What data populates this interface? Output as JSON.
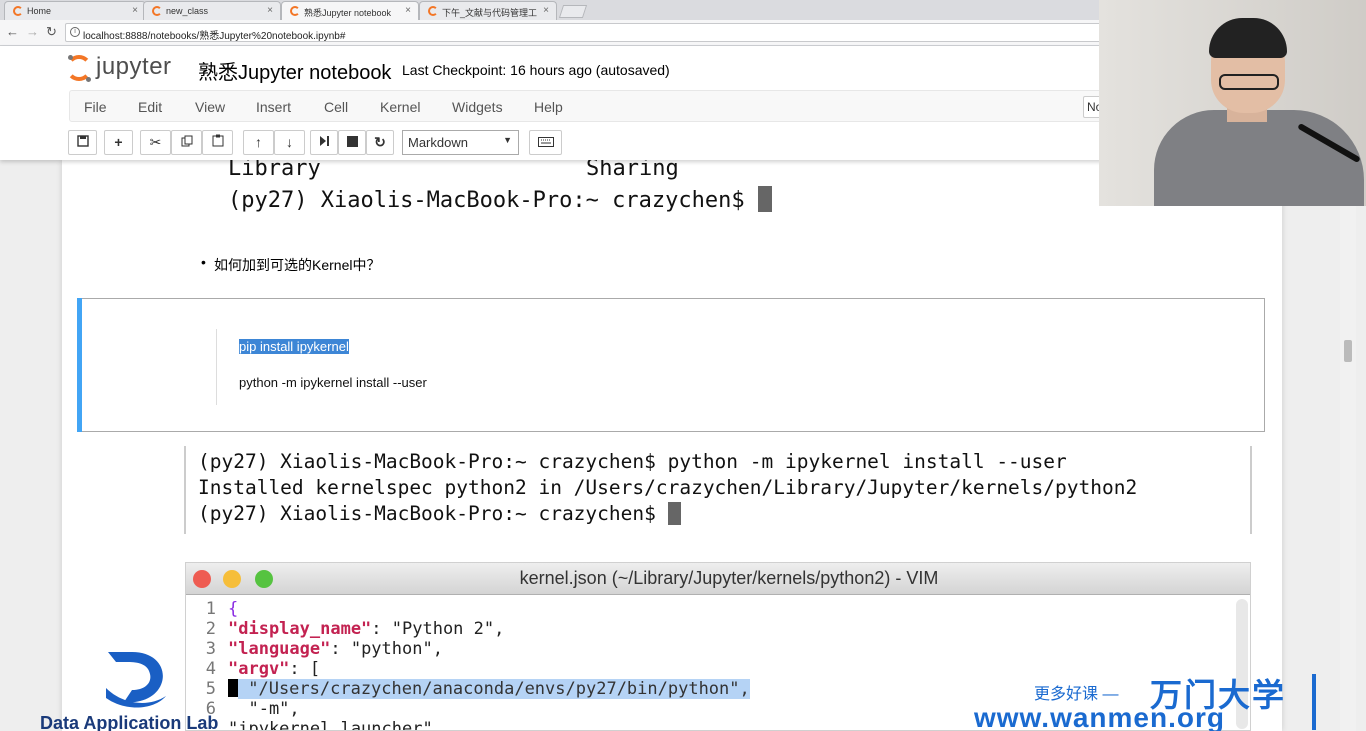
{
  "browser": {
    "tabs": [
      {
        "label": "Home",
        "active": false
      },
      {
        "label": "new_class",
        "active": false
      },
      {
        "label": "熟悉Jupyter notebook",
        "active": true
      },
      {
        "label": "下午_文献与代码管理工",
        "active": false
      }
    ],
    "close_glyph": "×",
    "url": "localhost:8888/notebooks/熟悉Jupyter%20notebook.ipynb#"
  },
  "jupyter": {
    "logo_text": "jupyter",
    "notebook_name": "熟悉Jupyter notebook",
    "checkpoint": "Last Checkpoint: 16 hours ago (autosaved)",
    "menu": [
      "File",
      "Edit",
      "View",
      "Insert",
      "Cell",
      "Kernel",
      "Widgets",
      "Help"
    ],
    "kernel_indicator": "No",
    "cell_type": "Markdown",
    "toolbar_icons": [
      "save-icon",
      "plus-icon",
      "scissors-icon",
      "copy-icon",
      "paste-icon",
      "arrow-up-icon",
      "arrow-down-icon",
      "run-icon",
      "stop-icon",
      "restart-icon",
      "keyboard-icon"
    ]
  },
  "content": {
    "terminal_top": {
      "line1_left": "Library",
      "line1_right": "Sharing",
      "line2": "(py27) Xiaolis-MacBook-Pro:~ crazychen$"
    },
    "bullet": "如何加到可选的Kernel中？",
    "markdown_cell": {
      "line1": "pip install ipykernel",
      "line2": "python -m ipykernel install --user"
    },
    "terminal2": [
      "(py27) Xiaolis-MacBook-Pro:~ crazychen$ python -m ipykernel install --user",
      "Installed kernelspec python2 in /Users/crazychen/Library/Jupyter/kernels/python2",
      "(py27) Xiaolis-MacBook-Pro:~ crazychen$"
    ],
    "vim": {
      "title": "kernel.json (~/Library/Jupyter/kernels/python2) - VIM",
      "lines": [
        {
          "n": "1",
          "t": "{"
        },
        {
          "n": "2",
          "k": "\"display_name\"",
          "v": ": \"Python 2\","
        },
        {
          "n": "3",
          "k": "\"language\"",
          "v": ": \"python\","
        },
        {
          "n": "4",
          "k": "\"argv\"",
          "v": ": ["
        },
        {
          "n": "5",
          "t": " \"/Users/crazychen/anaconda/envs/py27/bin/python\","
        },
        {
          "n": "6",
          "t": "  \"-m\","
        },
        {
          "n": "",
          "t": "\"ipykernel_launcher\","
        }
      ]
    }
  },
  "watermarks": {
    "dal": "Data Application Lab",
    "wanmen_small": "更多好课 —",
    "wanmen_big": "万门大学",
    "wanmen_url": "www.wanmen.org"
  },
  "colors": {
    "jupyter_orange": "#f37626",
    "cell_selected": "#42a5f5",
    "selection": "#3d86d6",
    "brand_blue": "#1a6ad0"
  }
}
